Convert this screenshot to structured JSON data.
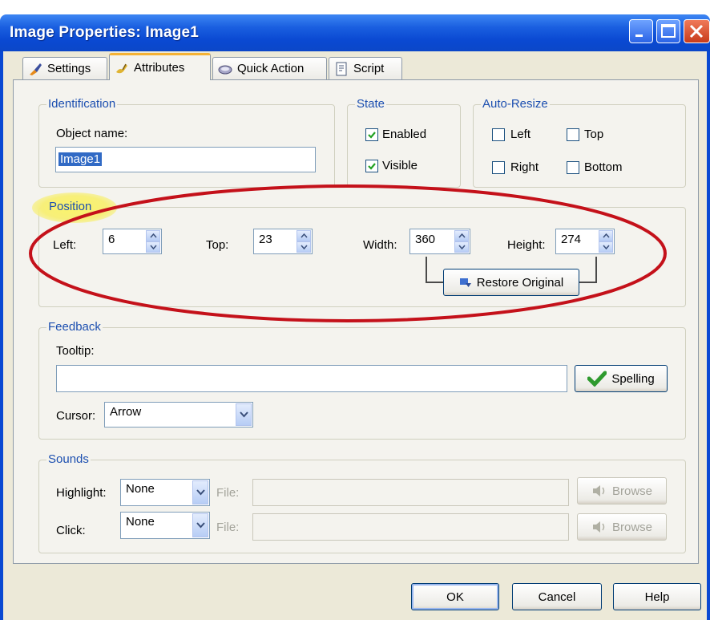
{
  "window": {
    "title": "Image Properties: Image1",
    "title_color": "#ffffff",
    "titlebar_color": "#0a49d2"
  },
  "tabs": [
    {
      "label": "Settings",
      "icon": "paint-brush-icon"
    },
    {
      "label": "Attributes",
      "icon": "brush-stroke-icon",
      "active": true
    },
    {
      "label": "Quick Action",
      "icon": "eraser-icon"
    },
    {
      "label": "Script",
      "icon": "script-page-icon"
    }
  ],
  "identification": {
    "title": "Identification",
    "object_name_label": "Object name:",
    "object_name_value": "Image1"
  },
  "state": {
    "title": "State",
    "enabled_label": "Enabled",
    "enabled_checked": true,
    "visible_label": "Visible",
    "visible_checked": true
  },
  "auto_resize": {
    "title": "Auto-Resize",
    "left_label": "Left",
    "top_label": "Top",
    "right_label": "Right",
    "bottom_label": "Bottom"
  },
  "position": {
    "title": "Position",
    "left_label": "Left:",
    "left_value": "6",
    "top_label": "Top:",
    "top_value": "23",
    "width_label": "Width:",
    "width_value": "360",
    "height_label": "Height:",
    "height_value": "274",
    "restore_label": "Restore Original",
    "highlight_color": "#c4111a"
  },
  "feedback": {
    "title": "Feedback",
    "tooltip_label": "Tooltip:",
    "tooltip_value": "",
    "spelling_label": "Spelling",
    "cursor_label": "Cursor:",
    "cursor_value": "Arrow"
  },
  "sounds": {
    "title": "Sounds",
    "highlight_label": "Highlight:",
    "highlight_value": "None",
    "click_label": "Click:",
    "click_value": "None",
    "file_label": "File:",
    "browse_label": "Browse"
  },
  "footer": {
    "ok_label": "OK",
    "cancel_label": "Cancel",
    "help_label": "Help"
  }
}
